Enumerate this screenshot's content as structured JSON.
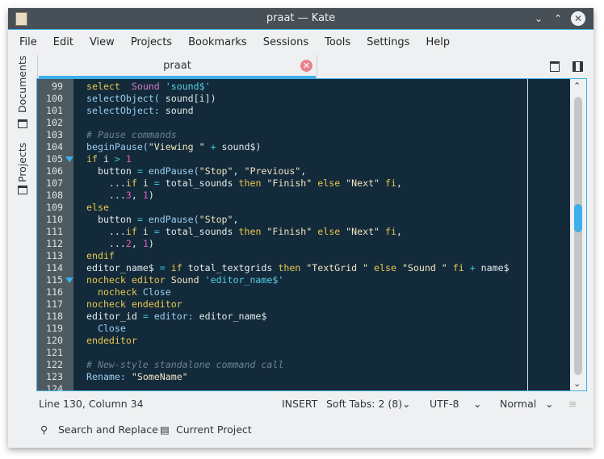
{
  "window": {
    "title": "praat  — Kate",
    "controls": [
      "minimize",
      "maximize",
      "close"
    ]
  },
  "menu": [
    "File",
    "Edit",
    "View",
    "Projects",
    "Bookmarks",
    "Sessions",
    "Tools",
    "Settings",
    "Help"
  ],
  "sidebar": {
    "tabs": [
      {
        "label": "Documents",
        "icon": "document-icon"
      },
      {
        "label": "Projects",
        "icon": "project-list-icon"
      }
    ]
  },
  "tabs": [
    {
      "label": "praat",
      "active": true
    }
  ],
  "colors": {
    "accent": "#3daee9",
    "editor_bg": "#132a3a",
    "gutter_bg": "#4d5a60",
    "keyword": "#e7c84f",
    "function": "#9ccff0",
    "string": "#f0e5c3",
    "comment": "#6b8394",
    "number": "#e05fbe",
    "operator": "#3ac6d8"
  },
  "editor": {
    "scroll_position_percent": 45,
    "lines": [
      {
        "n": "99",
        "t": [
          [
            "kw",
            "select"
          ],
          [
            "",
            "  "
          ],
          [
            "cls",
            "Sound"
          ],
          [
            "",
            " "
          ],
          [
            "scls",
            "'sound$'"
          ]
        ]
      },
      {
        "n": "100",
        "t": [
          [
            "fn",
            "selectObject("
          ],
          [
            "",
            " sound[i])"
          ]
        ]
      },
      {
        "n": "101",
        "t": [
          [
            "fn",
            "selectObject:"
          ],
          [
            "",
            " sound"
          ]
        ]
      },
      {
        "n": "102",
        "t": []
      },
      {
        "n": "103",
        "t": [
          [
            "com",
            "# Pause commands"
          ]
        ]
      },
      {
        "n": "104",
        "t": [
          [
            "fn",
            "beginPause("
          ],
          [
            "str",
            "\"Viewing \""
          ],
          [
            "",
            " "
          ],
          [
            "op",
            "+"
          ],
          [
            "",
            " sound$)"
          ]
        ]
      },
      {
        "n": "105",
        "fold": true,
        "t": [
          [
            "kw",
            "if"
          ],
          [
            "",
            " i "
          ],
          [
            "op",
            ">"
          ],
          [
            "",
            " "
          ],
          [
            "num",
            "1"
          ]
        ]
      },
      {
        "n": "106",
        "t": [
          [
            "",
            "  button "
          ],
          [
            "op",
            "="
          ],
          [
            "",
            " "
          ],
          [
            "fn",
            "endPause("
          ],
          [
            "str",
            "\"Stop\""
          ],
          [
            "",
            ", "
          ],
          [
            "str",
            "\"Previous\""
          ],
          [
            "",
            ","
          ]
        ]
      },
      {
        "n": "107",
        "t": [
          [
            "",
            "    ..."
          ],
          [
            "kw",
            "if"
          ],
          [
            "",
            " i "
          ],
          [
            "op",
            "="
          ],
          [
            "",
            " total_sounds "
          ],
          [
            "kw",
            "then"
          ],
          [
            "",
            " "
          ],
          [
            "str",
            "\"Finish\""
          ],
          [
            "",
            " "
          ],
          [
            "kw",
            "else"
          ],
          [
            "",
            " "
          ],
          [
            "str",
            "\"Next\""
          ],
          [
            "",
            " "
          ],
          [
            "kw",
            "fi"
          ],
          [
            "",
            ","
          ]
        ]
      },
      {
        "n": "108",
        "t": [
          [
            "",
            "    ..."
          ],
          [
            "num",
            "3"
          ],
          [
            "",
            ", "
          ],
          [
            "num",
            "1"
          ],
          [
            "",
            ")"
          ]
        ]
      },
      {
        "n": "109",
        "t": [
          [
            "kw",
            "else"
          ]
        ]
      },
      {
        "n": "110",
        "t": [
          [
            "",
            "  button "
          ],
          [
            "op",
            "="
          ],
          [
            "",
            " "
          ],
          [
            "fn",
            "endPause("
          ],
          [
            "str",
            "\"Stop\""
          ],
          [
            "",
            ","
          ]
        ]
      },
      {
        "n": "111",
        "t": [
          [
            "",
            "    ..."
          ],
          [
            "kw",
            "if"
          ],
          [
            "",
            " i "
          ],
          [
            "op",
            "="
          ],
          [
            "",
            " total_sounds "
          ],
          [
            "kw",
            "then"
          ],
          [
            "",
            " "
          ],
          [
            "str",
            "\"Finish\""
          ],
          [
            "",
            " "
          ],
          [
            "kw",
            "else"
          ],
          [
            "",
            " "
          ],
          [
            "str",
            "\"Next\""
          ],
          [
            "",
            " "
          ],
          [
            "kw",
            "fi"
          ],
          [
            "",
            ","
          ]
        ]
      },
      {
        "n": "112",
        "t": [
          [
            "",
            "    ..."
          ],
          [
            "num",
            "2"
          ],
          [
            "",
            ", "
          ],
          [
            "num",
            "1"
          ],
          [
            "",
            ")"
          ]
        ]
      },
      {
        "n": "113",
        "t": [
          [
            "kw",
            "endif"
          ]
        ]
      },
      {
        "n": "114",
        "t": [
          [
            "",
            "editor_name$ "
          ],
          [
            "op",
            "="
          ],
          [
            "",
            " "
          ],
          [
            "kw",
            "if"
          ],
          [
            "",
            " total_textgrids "
          ],
          [
            "kw",
            "then"
          ],
          [
            "",
            " "
          ],
          [
            "str",
            "\"TextGrid \""
          ],
          [
            "",
            " "
          ],
          [
            "kw",
            "else"
          ],
          [
            "",
            " "
          ],
          [
            "str",
            "\"Sound \""
          ],
          [
            "",
            " "
          ],
          [
            "kw",
            "fi"
          ],
          [
            "",
            " "
          ],
          [
            "op",
            "+"
          ],
          [
            "",
            " name$"
          ]
        ]
      },
      {
        "n": "115",
        "fold": true,
        "t": [
          [
            "kw",
            "nocheck editor"
          ],
          [
            "",
            " "
          ],
          [
            "str",
            "Sound"
          ],
          [
            "",
            " "
          ],
          [
            "scls",
            "'editor_name$'"
          ]
        ]
      },
      {
        "n": "116",
        "t": [
          [
            "",
            "  "
          ],
          [
            "kw",
            "nocheck"
          ],
          [
            "",
            " "
          ],
          [
            "fn",
            "Close"
          ]
        ]
      },
      {
        "n": "117",
        "t": [
          [
            "kw",
            "nocheck endeditor"
          ]
        ]
      },
      {
        "n": "118",
        "t": [
          [
            "",
            "editor_id "
          ],
          [
            "op",
            "="
          ],
          [
            "",
            " "
          ],
          [
            "fn",
            "editor:"
          ],
          [
            "",
            " editor_name$"
          ]
        ]
      },
      {
        "n": "119",
        "t": [
          [
            "",
            "  "
          ],
          [
            "fn",
            "Close"
          ]
        ]
      },
      {
        "n": "120",
        "t": [
          [
            "kw",
            "endeditor"
          ]
        ]
      },
      {
        "n": "121",
        "t": []
      },
      {
        "n": "122",
        "t": [
          [
            "com",
            "# New-style standalone command call"
          ]
        ]
      },
      {
        "n": "123",
        "t": [
          [
            "fn",
            "Rename:"
          ],
          [
            "",
            " "
          ],
          [
            "str",
            "\"SomeName\""
          ]
        ]
      },
      {
        "n": "124",
        "t": []
      }
    ]
  },
  "status": {
    "position": "Line 130, Column 34",
    "mode": "INSERT",
    "indent": "Soft Tabs: 2 (8)",
    "encoding": "UTF-8",
    "syntax": "Normal"
  },
  "bottom": {
    "search": "Search and Replace",
    "project": "Current Project"
  }
}
